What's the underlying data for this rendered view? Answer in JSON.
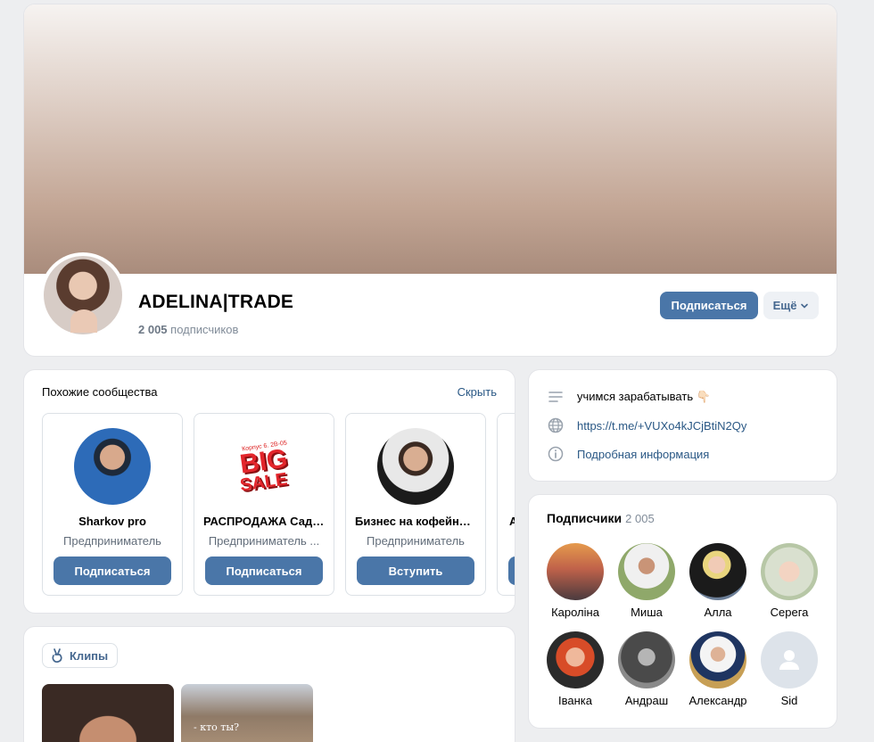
{
  "header": {
    "name": "ADELINA|TRADE",
    "subscribers_count": "2 005",
    "subscribers_label": "подписчиков",
    "subscribe_label": "Подписаться",
    "more_label": "Ещё"
  },
  "similar": {
    "title": "Похожие сообщества",
    "hide_label": "Скрыть",
    "items": [
      {
        "name": "Sharkov pro",
        "category": "Предприниматель",
        "action": "Подписаться"
      },
      {
        "name": "РАСПРОДАЖА Садовод...",
        "category": "Предприниматель ...",
        "action": "Подписаться",
        "logo_small": "Корпус 6. 2В-05",
        "logo_big": "BIG",
        "logo_sale": "SALE"
      },
      {
        "name": "Бизнес на кофейнях...",
        "category": "Предприниматель",
        "action": "Вступить"
      },
      {
        "name": "А",
        "category": "",
        "action": ""
      }
    ]
  },
  "clips": {
    "label": "Клипы",
    "clip2_caption": "- кто ты?"
  },
  "info": {
    "status": "учимся зарабатывать 👇🏻",
    "link": "https://t.me/+VUXo4kJCjBtiN2Qy",
    "details": "Подробная информация"
  },
  "followers": {
    "title": "Подписчики",
    "count": "2 005",
    "items": [
      {
        "name": "Кароліна"
      },
      {
        "name": "Миша"
      },
      {
        "name": "Алла"
      },
      {
        "name": "Серега"
      },
      {
        "name": "Іванка"
      },
      {
        "name": "Андраш"
      },
      {
        "name": "Александр"
      },
      {
        "name": "Sid"
      }
    ]
  },
  "colors": {
    "accent": "#4a76a8",
    "link": "#2a5885",
    "background": "#edeef0"
  }
}
